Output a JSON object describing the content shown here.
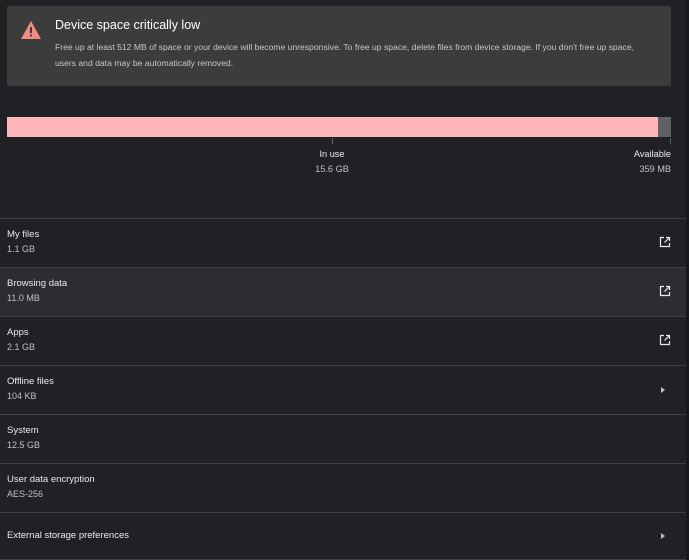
{
  "banner": {
    "title": "Device space critically low",
    "message": "Free up at least 512 MB of space or your device will become unresponsive. To free up space, delete files from device storage. If you don't free up space, users and data may be automatically removed.",
    "icon": "warning-icon",
    "accent_color": "#f28b82"
  },
  "usage": {
    "in_use_fraction": 0.98,
    "in_use_label": "In use",
    "in_use_value": "15.6 GB",
    "available_label": "Available",
    "available_value": "359 MB",
    "fill_color": "#ffb6bb"
  },
  "rows": [
    {
      "label": "My files",
      "value": "1.1 GB",
      "icon": "open-external-icon"
    },
    {
      "label": "Browsing data",
      "value": "11.0 MB",
      "icon": "open-external-icon"
    },
    {
      "label": "Apps",
      "value": "2.1 GB",
      "icon": "open-external-icon"
    },
    {
      "label": "Offline files",
      "value": "104 KB",
      "icon": "chevron-right-icon"
    },
    {
      "label": "System",
      "value": "12.5 GB"
    },
    {
      "label": "User data encryption",
      "value": "AES-256"
    },
    {
      "label": "External storage preferences",
      "icon": "chevron-right-icon"
    }
  ]
}
